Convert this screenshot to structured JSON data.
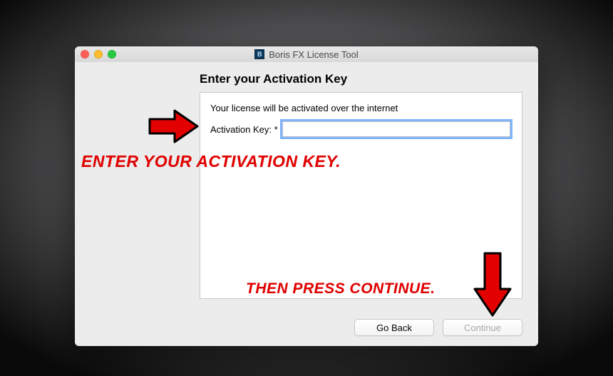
{
  "window": {
    "title": "Boris FX License Tool"
  },
  "heading": "Enter your Activation Key",
  "info_text": "Your license will be activated over the internet",
  "field": {
    "label": "Activation Key: *",
    "value": ""
  },
  "buttons": {
    "back": "Go Back",
    "continue": "Continue"
  },
  "annotations": {
    "enter_key": "ENTER YOUR ACTIVATION KEY.",
    "press_continue": "THEN PRESS CONTINUE."
  },
  "colors": {
    "annotation_red": "#e30000",
    "focus_ring": "#7eb3ff"
  }
}
